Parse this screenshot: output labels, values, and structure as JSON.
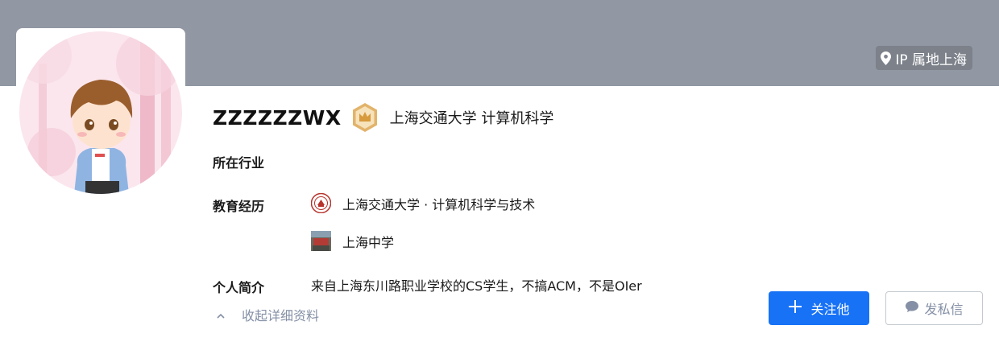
{
  "header": {
    "ip_location": "IP 属地上海"
  },
  "profile": {
    "username": "ZZZZZZWX",
    "headline": "上海交通大学 计算机科学"
  },
  "details": {
    "industry_label": "所在行业",
    "education_label": "教育经历",
    "education": [
      {
        "school": "上海交通大学 · 计算机科学与技术",
        "logo": "sjtu-seal-icon"
      },
      {
        "school": "上海中学",
        "logo": "school-building-icon"
      }
    ],
    "bio_label": "个人简介",
    "bio": "来自上海东川路职业学校的CS学生，不搞ACM，不是OIer"
  },
  "actions": {
    "collapse_label": "收起详细资料",
    "follow_label": "关注他",
    "message_label": "发私信"
  },
  "colors": {
    "accent": "#1772f6",
    "banner": "#9197a3",
    "muted": "#8590a6"
  }
}
